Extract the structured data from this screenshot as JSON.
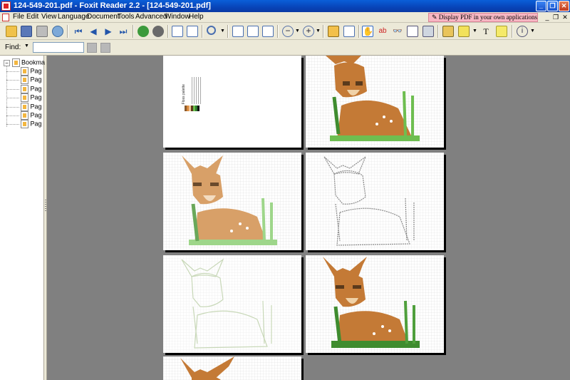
{
  "window": {
    "title": "124-549-201.pdf - Foxit Reader 2.2 - [124-549-201.pdf]"
  },
  "menu": {
    "items": [
      "File",
      "Edit",
      "View",
      "Language",
      "Document",
      "Tools",
      "Advanced",
      "Window",
      "Help"
    ],
    "promo": "Display PDF in your own applications"
  },
  "toolbar": {
    "icons": [
      "open-icon",
      "save-icon",
      "print-icon",
      "email-icon",
      "first-page-icon",
      "previous-page-icon",
      "next-page-icon",
      "last-page-icon",
      "go-back-icon",
      "go-forward-icon",
      "rotate-left-icon",
      "rotate-right-icon",
      "zoom-icon",
      "actual-size-icon",
      "fit-page-icon",
      "fit-width-icon",
      "zoom-out-icon",
      "zoom-in-icon",
      "continuous-view-icon",
      "facing-view-icon",
      "hand-tool-icon",
      "select-text-icon",
      "find-binoculars-icon",
      "snapshot-icon",
      "camera-icon",
      "form-icon",
      "highlight-icon",
      "typewriter-icon",
      "note-icon",
      "info-icon"
    ]
  },
  "find": {
    "label": "Find:",
    "value": ""
  },
  "bookmarks": {
    "root": "Bookma",
    "items": [
      "Pag",
      "Pag",
      "Pag",
      "Pag",
      "Pag",
      "Pag",
      "Pag"
    ]
  },
  "pages": {
    "palette_title": "Floss palette",
    "palette_colors": [
      "#8b5a2b",
      "#d98a3d",
      "#f3c79a",
      "#5a3a1c",
      "#6abf4b",
      "#2e7a2e",
      "#111111"
    ]
  },
  "colors": {
    "titlebar": "#0a5fd9",
    "chrome": "#ece9d8",
    "workspace": "#808080",
    "deer_brown": "#c47a36",
    "deer_light": "#f0d2a8",
    "grass": "#6ebe50"
  }
}
